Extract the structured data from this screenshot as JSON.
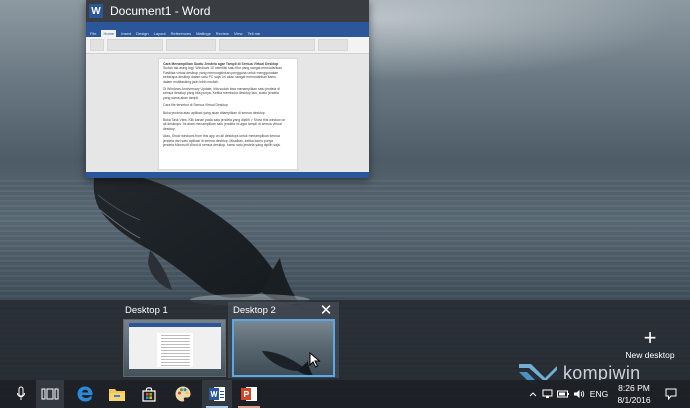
{
  "word_window": {
    "title": "Document1 - Word",
    "app_icon_letter": "W",
    "ribbon_tabs": [
      "File",
      "Home",
      "Insert",
      "Design",
      "Layout",
      "References",
      "Mailings",
      "Review",
      "View",
      "Tell me"
    ],
    "document_lines": [
      "Cara Menampilkan Suatu Jendela agar Tampil di Semua Virtual Desktop",
      "Sudah tak asing lagi, Windows 10 memiliki satu fitur yang sangat memudahkan",
      "Fasilitas virtual desktop yang memungkinkan pengguna untuk menggunakan",
      "beberapa desktop dalam satu PC saja. Ini akan sangat memudahkan kamu",
      "dalam multitasking jauh lebih mudah.",
      "",
      "Di Windows Anniversary Update, kita sudah bisa menampilkan satu jendela di",
      "semua desktop yang kita punya. Ketika membuka desktop lain, suatu jendela",
      "yang sama akan tampil.",
      "",
      "Cara file tersebut di Semua Virtual Desktop",
      "",
      "Buka jendela atau aplikasi yang akan ditampilkan di semua desktop.",
      "",
      "Buka Task View. Klik kanan pada satu jendela yang dipilih > Show this window on",
      "all desktops. Ini akan menampilkan satu jendela ini agar tampil di semua virtual",
      "desktop.",
      "",
      "Atau, Show windows from this app on all desktops untuk menampilkan semua",
      "jendela dari satu aplikasi di semua desktop. Misalkan, ketika kamu punya",
      "jendela Microsoft Word di semua desktop, kamu satu jendela yang dipilih saja."
    ]
  },
  "task_view": {
    "desktops": [
      {
        "label": "Desktop 1",
        "selected": false
      },
      {
        "label": "Desktop 2",
        "selected": true
      }
    ],
    "close_symbol": "✕",
    "new_desktop_symbol": "+",
    "new_desktop_label": "New desktop"
  },
  "taskbar": {
    "icons": [
      "microphone-icon",
      "task-view-icon",
      "edge-icon",
      "file-explorer-icon",
      "store-icon",
      "paint-icon",
      "word-icon",
      "powerpoint-icon"
    ],
    "language": "ENG",
    "time": "8:26 PM",
    "date": "8/1/2016"
  },
  "watermark": {
    "text": "kompiwin"
  },
  "colors": {
    "selection_border": "#5aa9e6",
    "word_blue": "#2b579a",
    "powerpoint_red": "#d24726",
    "edge_blue": "#2b8ad8"
  }
}
